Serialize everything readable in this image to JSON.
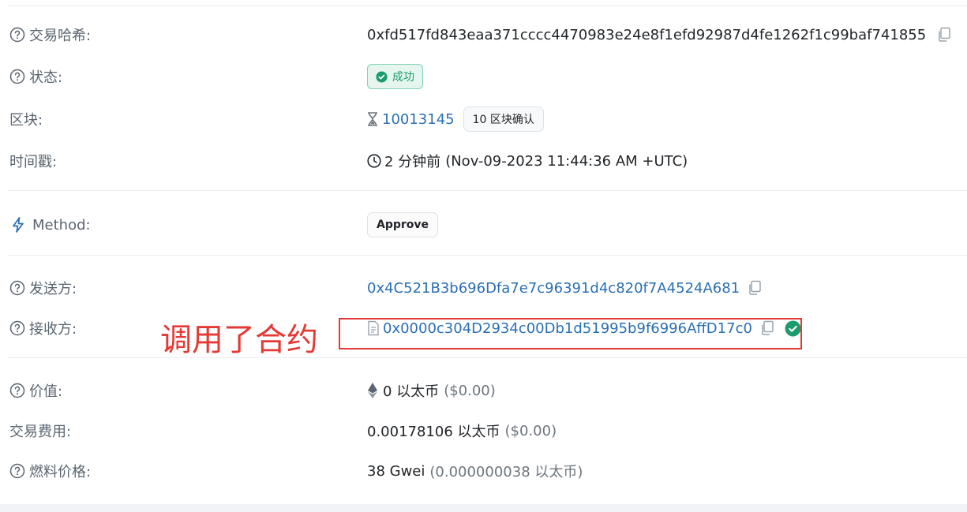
{
  "tx_hash": {
    "label": "交易哈希:",
    "value": "0xfd517fd843eaa371cccc4470983e24e8f1efd92987d4fe1262f1c99baf741855"
  },
  "status": {
    "label": "状态:",
    "value": "成功"
  },
  "block": {
    "label": "区块:",
    "number": "10013145",
    "confirmations": "10 区块确认"
  },
  "timestamp": {
    "label": "时间戳:",
    "relative": "2 分钟前",
    "absolute": "(Nov-09-2023 11:44:36 AM +UTC)"
  },
  "method": {
    "label": "Method:",
    "value": "Approve"
  },
  "from": {
    "label": "发送方:",
    "address": "0x4C521B3b696Dfa7e7c96391d4c820f7A4524A681"
  },
  "to": {
    "label": "接收方:",
    "address": "0x0000c304D2934c00Db1d51995b9f6996AffD17c0"
  },
  "value": {
    "label": "价值:",
    "amount": "0 以太币",
    "usd": "($0.00)"
  },
  "fee": {
    "label": "交易费用:",
    "amount": "0.00178106 以太币",
    "usd": "($0.00)"
  },
  "gas_price": {
    "label": "燃料价格:",
    "amount": "38 Gwei",
    "detail": "(0.000000038 以太币)"
  },
  "annotation": {
    "text": "调用了合约"
  },
  "colors": {
    "accent": "#2a6fb3",
    "success": "#1c9b6e",
    "annotation": "#e53935"
  }
}
